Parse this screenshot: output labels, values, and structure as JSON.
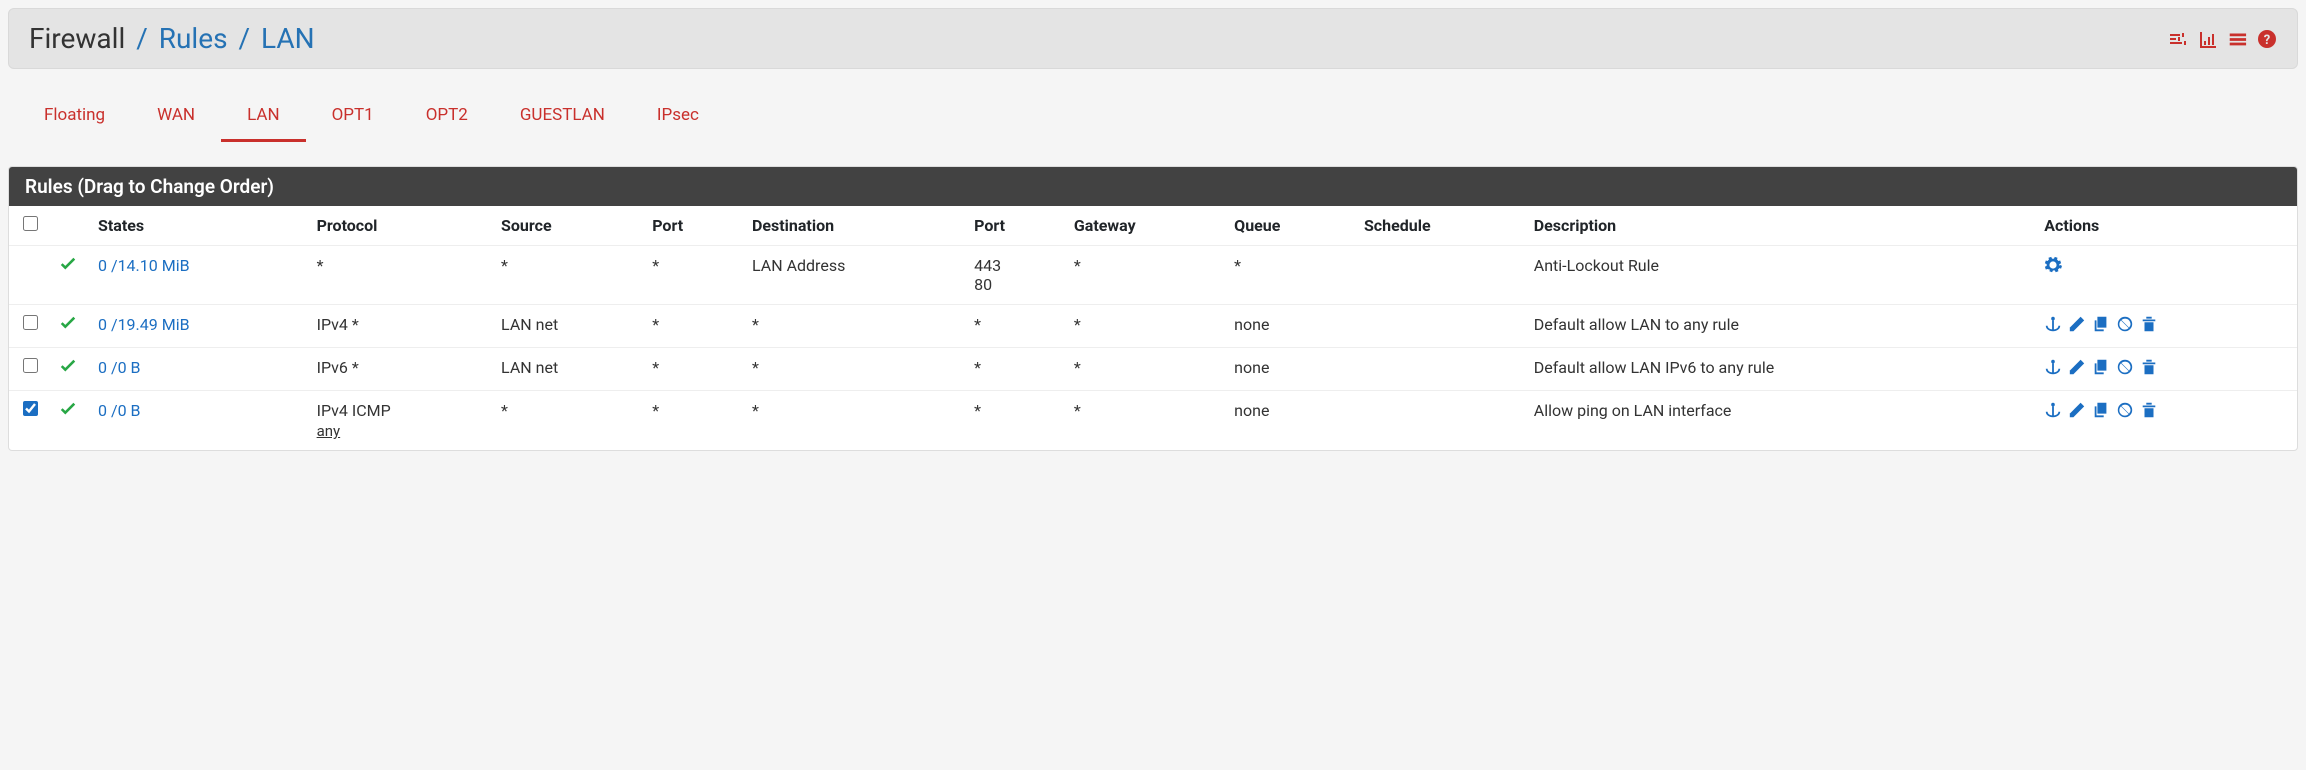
{
  "breadcrumb": {
    "root": "Firewall",
    "mid": "Rules",
    "leaf": "LAN"
  },
  "tabs": [
    "Floating",
    "WAN",
    "LAN",
    "OPT1",
    "OPT2",
    "GUESTLAN",
    "IPsec"
  ],
  "active_tab": "LAN",
  "panel_title": "Rules (Drag to Change Order)",
  "columns": [
    "",
    "",
    "States",
    "Protocol",
    "Source",
    "Port",
    "Destination",
    "Port",
    "Gateway",
    "Queue",
    "Schedule",
    "Description",
    "Actions"
  ],
  "rows": [
    {
      "checkbox": null,
      "checked": false,
      "status": "pass",
      "states": "0 /14.10 MiB",
      "protocol": "*",
      "protocol_sub": "",
      "source": "*",
      "sport": "*",
      "destination": "LAN Address",
      "dport": "443\n80",
      "gateway": "*",
      "queue": "*",
      "schedule": "",
      "description": "Anti-Lockout Rule",
      "actions": "settings"
    },
    {
      "checkbox": true,
      "checked": false,
      "status": "pass",
      "states": "0 /19.49 MiB",
      "protocol": "IPv4 *",
      "protocol_sub": "",
      "source": "LAN net",
      "sport": "*",
      "destination": "*",
      "dport": "*",
      "gateway": "*",
      "queue": "none",
      "schedule": "",
      "description": "Default allow LAN to any rule",
      "actions": "full"
    },
    {
      "checkbox": true,
      "checked": false,
      "status": "pass",
      "states": "0 /0 B",
      "protocol": "IPv6 *",
      "protocol_sub": "",
      "source": "LAN net",
      "sport": "*",
      "destination": "*",
      "dport": "*",
      "gateway": "*",
      "queue": "none",
      "schedule": "",
      "description": "Default allow LAN IPv6 to any rule",
      "actions": "full"
    },
    {
      "checkbox": true,
      "checked": true,
      "status": "pass",
      "states": "0 /0 B",
      "protocol": "IPv4 ICMP",
      "protocol_sub": "any",
      "source": "*",
      "sport": "*",
      "destination": "*",
      "dport": "*",
      "gateway": "*",
      "queue": "none",
      "schedule": "",
      "description": "Allow ping on LAN interface",
      "actions": "full"
    }
  ]
}
